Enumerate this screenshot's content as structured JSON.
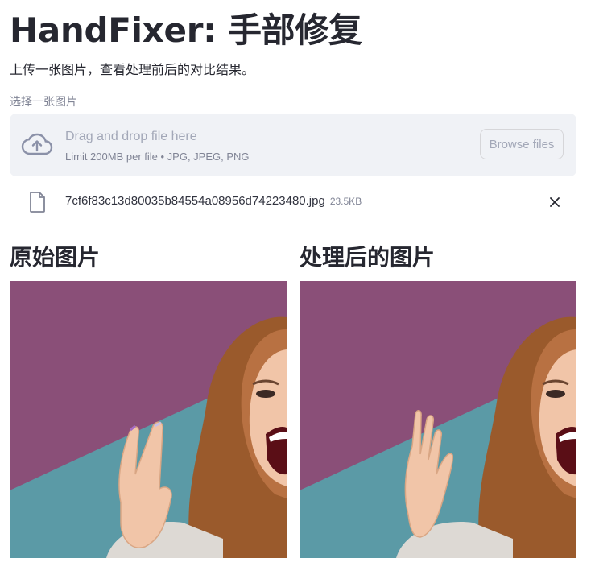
{
  "header": {
    "title": "HandFixer: 手部修复",
    "subtitle": "上传一张图片，查看处理前后的对比结果。"
  },
  "uploader": {
    "label": "选择一张图片",
    "drag_text": "Drag and drop file here",
    "limit_text": "Limit 200MB per file • JPG, JPEG, PNG",
    "browse_label": "Browse files",
    "icon": "cloud-upload-icon"
  },
  "uploaded_file": {
    "name": "7cf6f83c13d80035b84554a08956d74223480.jpg",
    "size": "23.5KB",
    "icon": "file-icon"
  },
  "columns": {
    "original_title": "原始图片",
    "processed_title": "处理后的图片"
  },
  "colors": {
    "purple_bg": "#8a4f78",
    "teal_bg": "#5b9aa6",
    "dropzone_bg": "#f0f2f6"
  }
}
